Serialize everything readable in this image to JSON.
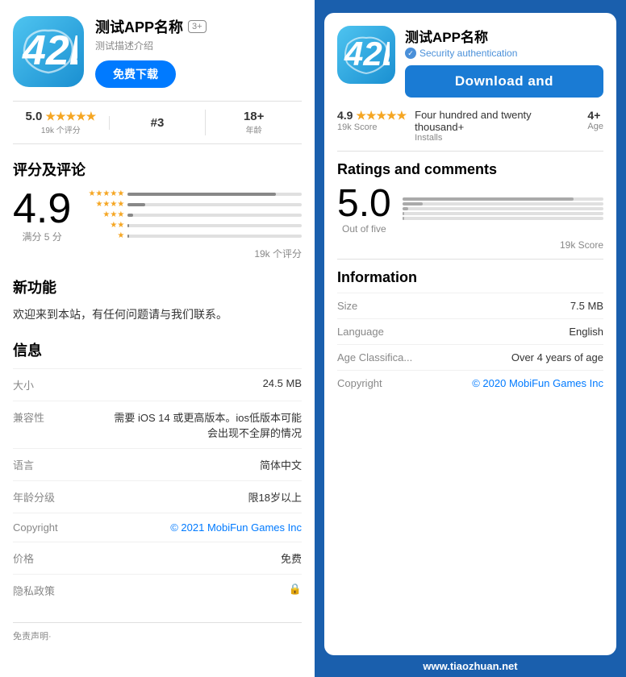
{
  "left": {
    "app_name": "测试APP名称",
    "age_badge": "3+",
    "subtitle": "测试描述介绍",
    "download_btn": "免费下载",
    "stats": {
      "rating": "5.0",
      "stars": "★★★★★",
      "review_count": "19k 个评分",
      "rank": "#3",
      "age": "18+",
      "age_label": "年龄"
    },
    "sections": {
      "ratings_title": "评分及评论",
      "big_score": "4.9",
      "score_label": "满分 5 分",
      "rating_count": "19k 个评分",
      "star_bars": [
        {
          "stars": "★★★★★",
          "width": "85%"
        },
        {
          "stars": "★★★★",
          "width": "10%"
        },
        {
          "stars": "★★★",
          "width": "3%"
        },
        {
          "stars": "★★",
          "width": "1%"
        },
        {
          "stars": "★",
          "width": "1%"
        }
      ],
      "new_features_title": "新功能",
      "new_features_text": "欢迎来到本站，有任何问题请与我们联系。",
      "info_title": "信息",
      "info_rows": [
        {
          "label": "大小",
          "value": "24.5 MB",
          "blue": false
        },
        {
          "label": "兼容性",
          "value": "需要 iOS 14 或更高版本。ios低版本可能会出现不全屏的情况",
          "blue": false
        },
        {
          "label": "语言",
          "value": "简体中文",
          "blue": false
        },
        {
          "label": "年龄分级",
          "value": "限18岁以上",
          "blue": false
        },
        {
          "label": "Copyright",
          "value": "© 2021 MobiFun Games Inc",
          "blue": true
        },
        {
          "label": "价格",
          "value": "免费",
          "blue": false
        },
        {
          "label": "隐私政策",
          "value": "🔒",
          "blue": false
        }
      ]
    },
    "footer": "免责声明·"
  },
  "right": {
    "app_name": "测试APP名称",
    "security_text": "Security authentication",
    "download_btn": "Download and",
    "stats": {
      "rating": "4.9",
      "stars": "★★★★★",
      "score_label": "19k Score",
      "installs_label": "Four hundred and twenty thousand+",
      "installs_sub": "Installs",
      "age": "4+",
      "age_label": "Age"
    },
    "sections": {
      "ratings_title": "Ratings and comments",
      "big_score": "5.0",
      "score_label": "Out of five",
      "rating_count": "19k Score",
      "star_bars": [
        {
          "width": "85%"
        },
        {
          "width": "10%"
        },
        {
          "width": "3%"
        },
        {
          "width": "1%"
        },
        {
          "width": "1%"
        }
      ],
      "info_title": "Information",
      "info_rows": [
        {
          "label": "Size",
          "value": "7.5 MB",
          "blue": false
        },
        {
          "label": "Language",
          "value": "English",
          "blue": false
        },
        {
          "label": "Age Classifica...",
          "value": "Over 4 years of age",
          "blue": false
        },
        {
          "label": "Copyright",
          "value": "© 2020 MobiFun Games Inc",
          "blue": true
        }
      ]
    },
    "watermark": "www.tiaozhuan.net"
  }
}
